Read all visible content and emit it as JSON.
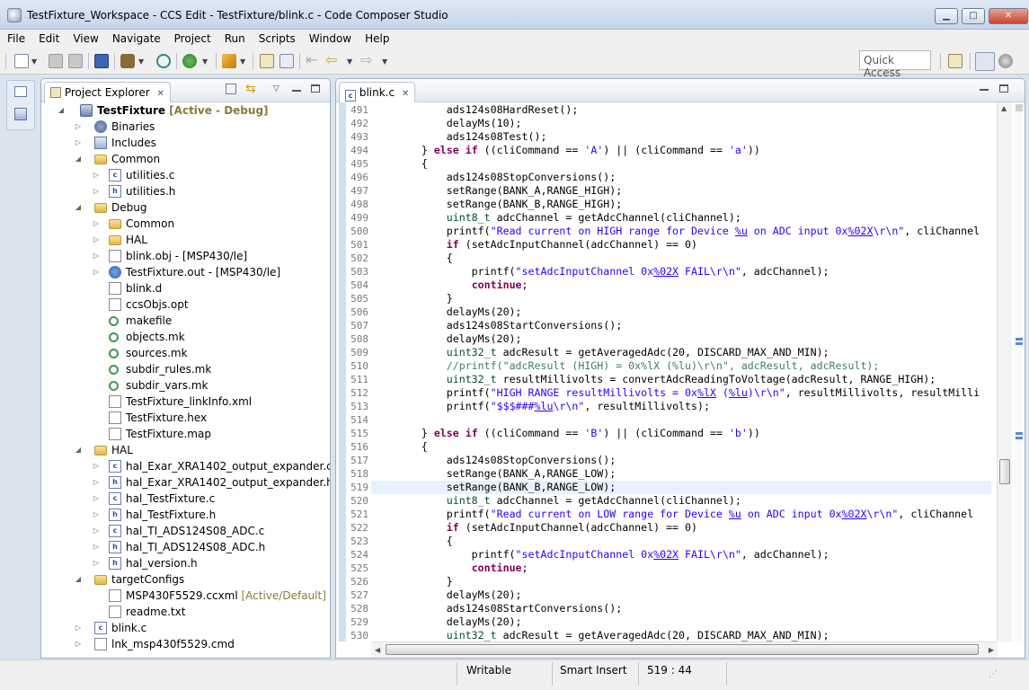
{
  "window": {
    "title": "TestFixture_Workspace - CCS Edit - TestFixture/blink.c - Code Composer Studio",
    "minimize": "▁",
    "maximize": "□",
    "close": "✕"
  },
  "menu": [
    "File",
    "Edit",
    "View",
    "Navigate",
    "Project",
    "Run",
    "Scripts",
    "Window",
    "Help"
  ],
  "toolbar": {
    "quick_access_placeholder": "Quick Access"
  },
  "explorer": {
    "tab_label": "Project Explorer",
    "tree": [
      {
        "label": "TestFixture",
        "deco": "[Active - Debug]",
        "indent": 0,
        "twisty": "open",
        "icon": "proj",
        "bold": true
      },
      {
        "label": "Binaries",
        "deco": "",
        "indent": 1,
        "twisty": "closed",
        "icon": "bin"
      },
      {
        "label": "Includes",
        "deco": "",
        "indent": 1,
        "twisty": "closed",
        "icon": "incl"
      },
      {
        "label": "Common",
        "deco": "",
        "indent": 1,
        "twisty": "open",
        "icon": "folder"
      },
      {
        "label": "utilities.c",
        "deco": "",
        "indent": 2,
        "twisty": "closed",
        "icon": "cfile"
      },
      {
        "label": "utilities.h",
        "deco": "",
        "indent": 2,
        "twisty": "closed",
        "icon": "cfile"
      },
      {
        "label": "Debug",
        "deco": "",
        "indent": 1,
        "twisty": "open",
        "icon": "folder"
      },
      {
        "label": "Common",
        "deco": "",
        "indent": 2,
        "twisty": "closed",
        "icon": "folder"
      },
      {
        "label": "HAL",
        "deco": "",
        "indent": 2,
        "twisty": "closed",
        "icon": "folder"
      },
      {
        "label": "blink.obj - [MSP430/le]",
        "deco": "",
        "indent": 2,
        "twisty": "closed",
        "icon": "file"
      },
      {
        "label": "TestFixture.out - [MSP430/le]",
        "deco": "",
        "indent": 2,
        "twisty": "closed",
        "icon": "exe"
      },
      {
        "label": "blink.d",
        "deco": "",
        "indent": 2,
        "twisty": "none",
        "icon": "file"
      },
      {
        "label": "ccsObjs.opt",
        "deco": "",
        "indent": 2,
        "twisty": "none",
        "icon": "file"
      },
      {
        "label": "makefile",
        "deco": "",
        "indent": 2,
        "twisty": "none",
        "icon": "make"
      },
      {
        "label": "objects.mk",
        "deco": "",
        "indent": 2,
        "twisty": "none",
        "icon": "make"
      },
      {
        "label": "sources.mk",
        "deco": "",
        "indent": 2,
        "twisty": "none",
        "icon": "make"
      },
      {
        "label": "subdir_rules.mk",
        "deco": "",
        "indent": 2,
        "twisty": "none",
        "icon": "make"
      },
      {
        "label": "subdir_vars.mk",
        "deco": "",
        "indent": 2,
        "twisty": "none",
        "icon": "make"
      },
      {
        "label": "TestFixture_linkInfo.xml",
        "deco": "",
        "indent": 2,
        "twisty": "none",
        "icon": "file"
      },
      {
        "label": "TestFixture.hex",
        "deco": "",
        "indent": 2,
        "twisty": "none",
        "icon": "file"
      },
      {
        "label": "TestFixture.map",
        "deco": "",
        "indent": 2,
        "twisty": "none",
        "icon": "file"
      },
      {
        "label": "HAL",
        "deco": "",
        "indent": 1,
        "twisty": "open",
        "icon": "folder"
      },
      {
        "label": "hal_Exar_XRA1402_output_expander.c",
        "deco": "",
        "indent": 2,
        "twisty": "closed",
        "icon": "cfile"
      },
      {
        "label": "hal_Exar_XRA1402_output_expander.h",
        "deco": "",
        "indent": 2,
        "twisty": "closed",
        "icon": "cfile"
      },
      {
        "label": "hal_TestFixture.c",
        "deco": "",
        "indent": 2,
        "twisty": "closed",
        "icon": "cfile"
      },
      {
        "label": "hal_TestFixture.h",
        "deco": "",
        "indent": 2,
        "twisty": "closed",
        "icon": "cfile"
      },
      {
        "label": "hal_TI_ADS124S08_ADC.c",
        "deco": "",
        "indent": 2,
        "twisty": "closed",
        "icon": "cfile"
      },
      {
        "label": "hal_TI_ADS124S08_ADC.h",
        "deco": "",
        "indent": 2,
        "twisty": "closed",
        "icon": "cfile"
      },
      {
        "label": "hal_version.h",
        "deco": "",
        "indent": 2,
        "twisty": "closed",
        "icon": "cfile"
      },
      {
        "label": "targetConfigs",
        "deco": "",
        "indent": 1,
        "twisty": "open",
        "icon": "folder"
      },
      {
        "label": "MSP430F5529.ccxml",
        "deco": "[Active/Default]",
        "indent": 2,
        "twisty": "none",
        "icon": "file"
      },
      {
        "label": "readme.txt",
        "deco": "",
        "indent": 2,
        "twisty": "none",
        "icon": "file"
      },
      {
        "label": "blink.c",
        "deco": "",
        "indent": 1,
        "twisty": "closed",
        "icon": "cfile"
      },
      {
        "label": "lnk_msp430f5529.cmd",
        "deco": "",
        "indent": 1,
        "twisty": "closed",
        "icon": "file"
      }
    ]
  },
  "editor": {
    "tab_label": "blink.c",
    "current_line": 519,
    "lines": [
      {
        "n": 491,
        "code": "            ads124s08HardReset();"
      },
      {
        "n": 492,
        "code": "            delayMs(10);"
      },
      {
        "n": 493,
        "code": "            ads124s08Test();"
      },
      {
        "n": 494,
        "code": "        } else if ((cliCommand == 'A') || (cliCommand == 'a'))"
      },
      {
        "n": 495,
        "code": "        {"
      },
      {
        "n": 496,
        "code": "            ads124s08StopConversions();"
      },
      {
        "n": 497,
        "code": "            setRange(BANK_A,RANGE_HIGH);"
      },
      {
        "n": 498,
        "code": "            setRange(BANK_B,RANGE_HIGH);"
      },
      {
        "n": 499,
        "code": "            uint8_t adcChannel = getAdcChannel(cliChannel);"
      },
      {
        "n": 500,
        "code": "            printf(\"Read current on HIGH range for Device %u on ADC input 0x%02X\\r\\n\", cliChannel"
      },
      {
        "n": 501,
        "code": "            if (setAdcInputChannel(adcChannel) == 0)"
      },
      {
        "n": 502,
        "code": "            {"
      },
      {
        "n": 503,
        "code": "                printf(\"setAdcInputChannel 0x%02X FAIL\\r\\n\", adcChannel);"
      },
      {
        "n": 504,
        "code": "                continue;"
      },
      {
        "n": 505,
        "code": "            }"
      },
      {
        "n": 506,
        "code": "            delayMs(20);"
      },
      {
        "n": 507,
        "code": "            ads124s08StartConversions();"
      },
      {
        "n": 508,
        "code": "            delayMs(20);"
      },
      {
        "n": 509,
        "code": "            uint32_t adcResult = getAveragedAdc(20, DISCARD_MAX_AND_MIN);"
      },
      {
        "n": 510,
        "code": "            //printf(\"adcResult (HIGH) = 0x%lX (%lu)\\r\\n\", adcResult, adcResult);"
      },
      {
        "n": 511,
        "code": "            uint32_t resultMillivolts = convertAdcReadingToVoltage(adcResult, RANGE_HIGH);"
      },
      {
        "n": 512,
        "code": "            printf(\"HIGH RANGE resultMillivolts = 0x%lX (%lu)\\r\\n\", resultMillivolts, resultMilli"
      },
      {
        "n": 513,
        "code": "            printf(\"$$$###%lu\\r\\n\", resultMillivolts);"
      },
      {
        "n": 514,
        "code": ""
      },
      {
        "n": 515,
        "code": "        } else if ((cliCommand == 'B') || (cliCommand == 'b'))"
      },
      {
        "n": 516,
        "code": "        {"
      },
      {
        "n": 517,
        "code": "            ads124s08StopConversions();"
      },
      {
        "n": 518,
        "code": "            setRange(BANK_A,RANGE_LOW);"
      },
      {
        "n": 519,
        "code": "            setRange(BANK_B,RANGE_LOW);"
      },
      {
        "n": 520,
        "code": "            uint8_t adcChannel = getAdcChannel(cliChannel);"
      },
      {
        "n": 521,
        "code": "            printf(\"Read current on LOW range for Device %u on ADC input 0x%02X\\r\\n\", cliChannel"
      },
      {
        "n": 522,
        "code": "            if (setAdcInputChannel(adcChannel) == 0)"
      },
      {
        "n": 523,
        "code": "            {"
      },
      {
        "n": 524,
        "code": "                printf(\"setAdcInputChannel 0x%02X FAIL\\r\\n\", adcChannel);"
      },
      {
        "n": 525,
        "code": "                continue;"
      },
      {
        "n": 526,
        "code": "            }"
      },
      {
        "n": 527,
        "code": "            delayMs(20);"
      },
      {
        "n": 528,
        "code": "            ads124s08StartConversions();"
      },
      {
        "n": 529,
        "code": "            delayMs(20);"
      },
      {
        "n": 530,
        "code": "            uint32_t adcResult = getAveragedAdc(20, DISCARD_MAX_AND_MIN);"
      }
    ]
  },
  "statusbar": {
    "writable": "Writable",
    "insert_mode": "Smart Insert",
    "position": "519 : 44"
  },
  "colors": {
    "keyword": "#7f0055",
    "string": "#2a00ff",
    "comment": "#3f7f5f",
    "current_line": "#e8f2fe"
  }
}
